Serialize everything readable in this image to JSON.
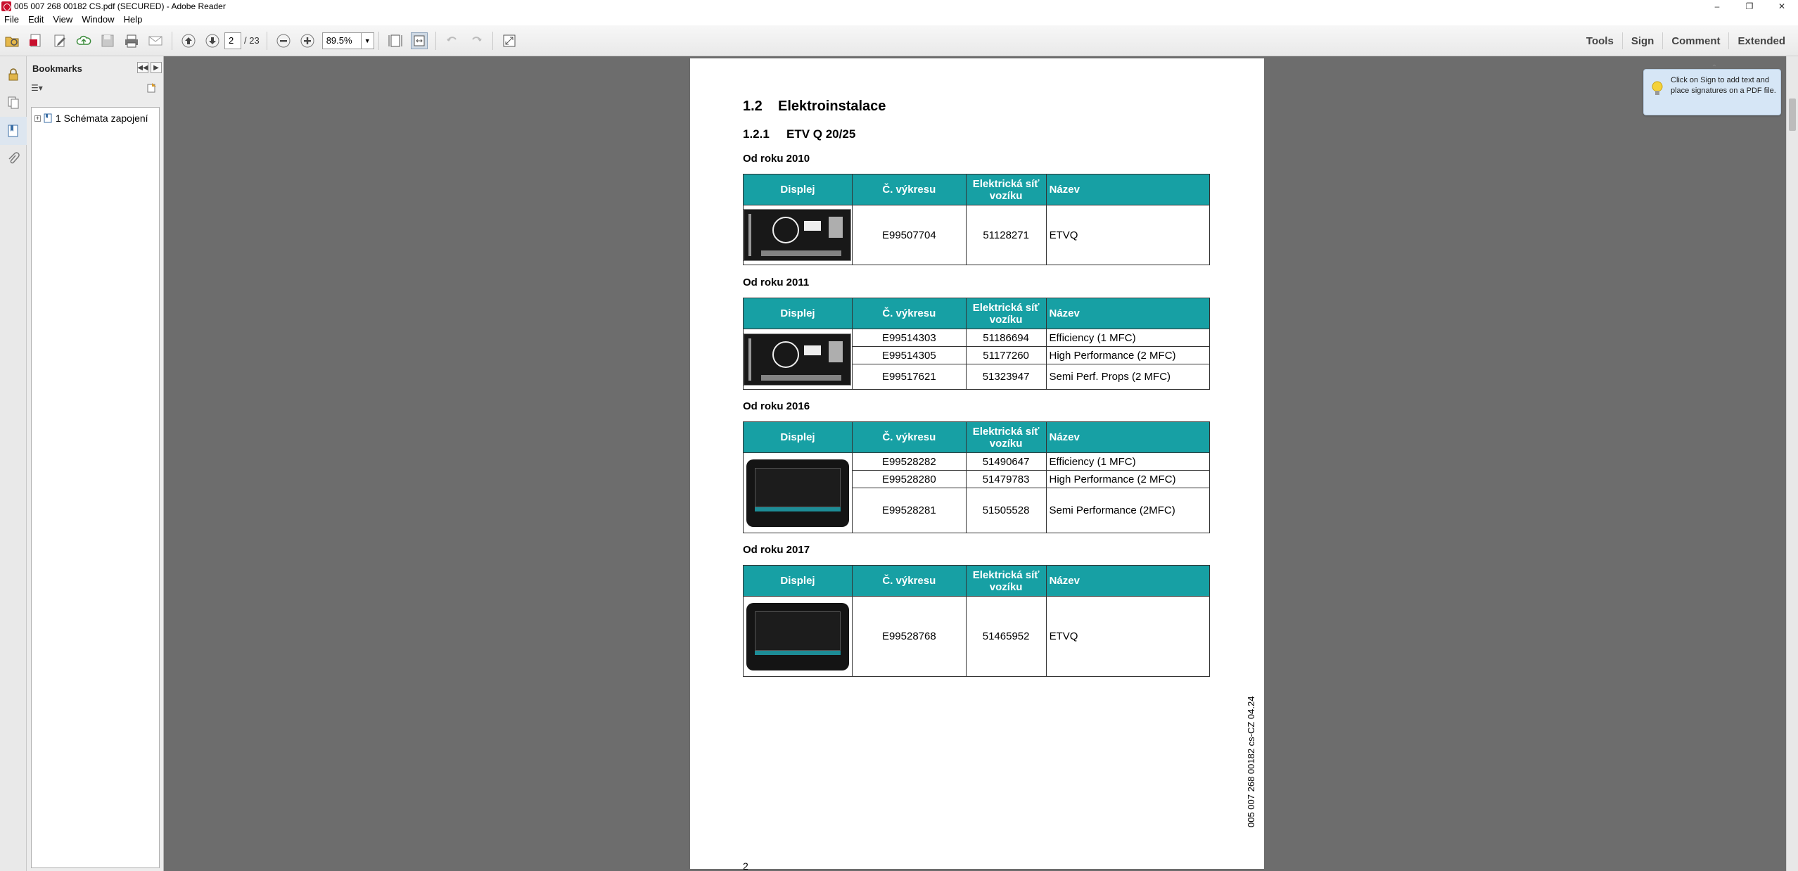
{
  "window": {
    "title": "005 007 268 00182 CS.pdf (SECURED) - Adobe Reader",
    "controls": {
      "minimize": "–",
      "restore": "❐",
      "close": "✕"
    }
  },
  "menu": [
    "File",
    "Edit",
    "View",
    "Window",
    "Help"
  ],
  "toolbar": {
    "page_current": "2",
    "page_total": "/ 23",
    "zoom": "89.5%",
    "right_links": [
      "Tools",
      "Sign",
      "Comment",
      "Extended"
    ]
  },
  "bookmarks": {
    "title": "Bookmarks",
    "items": [
      {
        "label": "1 Schémata zapojení",
        "expander": "+"
      }
    ]
  },
  "tooltip": {
    "text": "Click on Sign to add text and place signatures on a PDF file.",
    "caret": "⌃"
  },
  "document": {
    "heading1": {
      "num": "1.2",
      "text": "Elektroinstalace"
    },
    "heading2": {
      "num": "1.2.1",
      "text": "ETV Q 20/25"
    },
    "table_headers": [
      "Displej",
      "Č. výkresu",
      "Elektrická síť vozíku",
      "Název"
    ],
    "sections": [
      {
        "title": "Od roku 2010",
        "display": "lcd",
        "rows": [
          {
            "drawing": "E99507704",
            "network": "51128271",
            "name": "ETVQ"
          }
        ]
      },
      {
        "title": "Od roku 2011",
        "display": "lcd",
        "rows": [
          {
            "drawing": "E99514303",
            "network": "51186694",
            "name": "Efficiency (1 MFC)"
          },
          {
            "drawing": "E99514305",
            "network": "51177260",
            "name": "High Performance (2 MFC)"
          },
          {
            "drawing": "E99517621",
            "network": "51323947",
            "name": "Semi Perf. Props (2 MFC)"
          }
        ]
      },
      {
        "title": "Od roku 2016",
        "display": "tft",
        "rows": [
          {
            "drawing": "E99528282",
            "network": "51490647",
            "name": "Efficiency (1 MFC)"
          },
          {
            "drawing": "E99528280",
            "network": "51479783",
            "name": "High Performance (2 MFC)"
          },
          {
            "drawing": "E99528281",
            "network": "51505528",
            "name": "Semi Performance (2MFC)"
          }
        ]
      },
      {
        "title": "Od roku 2017",
        "display": "tft",
        "rows": [
          {
            "drawing": "E99528768",
            "network": "51465952",
            "name": "ETVQ"
          }
        ]
      }
    ],
    "page_number": "2",
    "side_text": "005 007 268 00182 cs-CZ 04.24"
  }
}
